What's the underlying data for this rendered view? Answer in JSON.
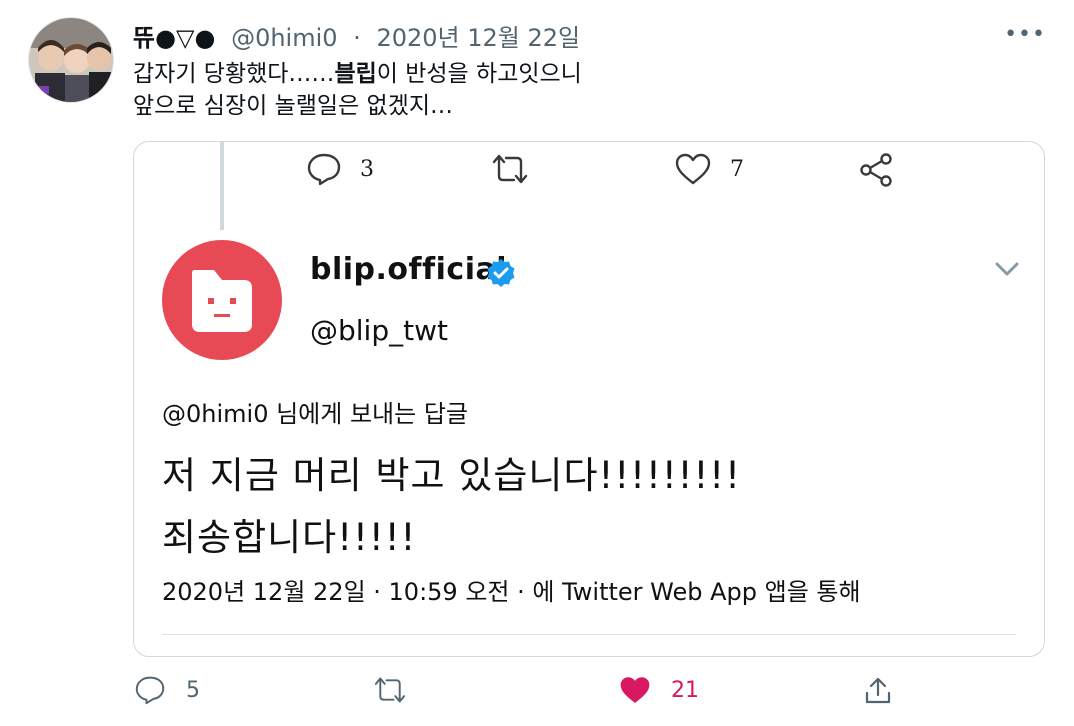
{
  "tweet": {
    "display_name": "뜌●▽●",
    "handle": "@0himi0",
    "separator": "·",
    "date": "2020년 12월 22일",
    "text_part1": "갑자기 당황했다……",
    "text_bold": "블립",
    "text_part2": "이 반성을 하고잇으니",
    "text_line2": "앞으로 심장이 놀랠일은 없겠지…",
    "more_icon": "more-dots-icon"
  },
  "embedded": {
    "actions": {
      "replies": "3",
      "likes": "7"
    },
    "name": "blip.official",
    "handle": "@blip_twt",
    "reply_to": "@0himi0 님에게 보내는 답글",
    "line1": "저 지금 머리 박고 있습니다!!!!!!!!!",
    "line2": "죄송합니다!!!!!",
    "timestamp": "2020년 12월 22일 · 10:59 오전 · 에 Twitter Web App 앱을 통해",
    "brand_color": "#e84a55",
    "verified_color": "#1d9bf0"
  },
  "bottom_actions": {
    "replies": "5",
    "likes": "21",
    "liked_color": "#d91862"
  }
}
